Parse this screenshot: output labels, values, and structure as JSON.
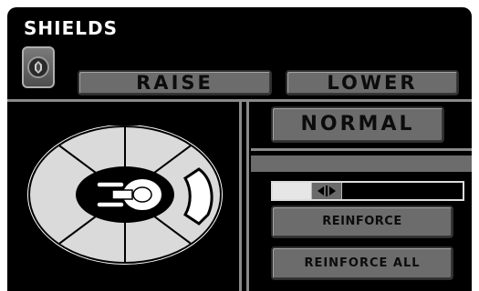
{
  "panel": {
    "title": "SHIELDS"
  },
  "icons": {
    "shield_toggle": "shield-icon",
    "ship": "starship-icon",
    "slider_arrows": "left-right-arrows-icon"
  },
  "buttons": {
    "raise": "RAISE",
    "lower": "LOWER",
    "normal": "NORMAL",
    "reinforce": "REINFORCE",
    "reinforce_all": "REINFORCE  ALL"
  },
  "shield_slider": {
    "level": 0.24
  },
  "shield_sectors": [
    "top-left",
    "top-right",
    "right",
    "bottom-right",
    "bottom-left",
    "left"
  ],
  "selected_sector": "right",
  "colors": {
    "panel_background": "#000000",
    "button_face": "#6c6c6c",
    "shield_sector": "#dadada",
    "shield_sector_selected": "#ffffff",
    "title_text": "#ffffff"
  }
}
